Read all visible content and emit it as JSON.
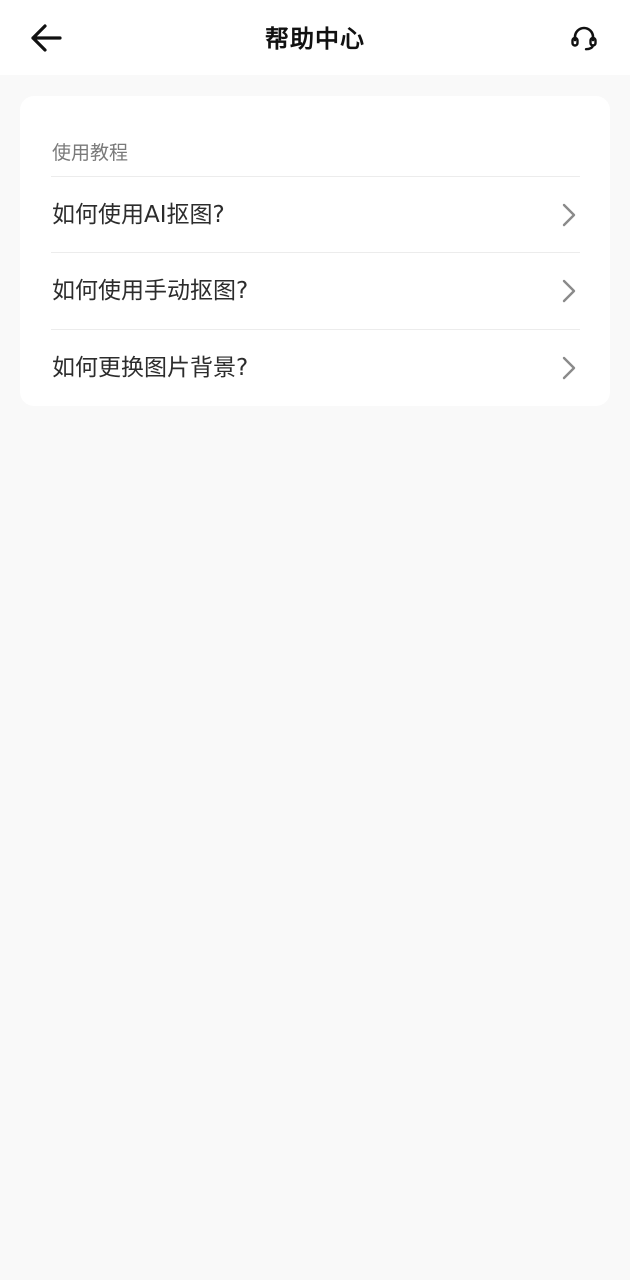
{
  "header": {
    "back_icon": "arrow-left-icon",
    "title": "帮助中心",
    "support_icon": "headset-icon"
  },
  "tutorials": {
    "section_label": "使用教程",
    "items": [
      {
        "label": "如何使用AI抠图?",
        "icon": "chevron-right-icon"
      },
      {
        "label": "如何使用手动抠图?",
        "icon": "chevron-right-icon"
      },
      {
        "label": "如何更换图片背景?",
        "icon": "chevron-right-icon"
      }
    ]
  },
  "colors": {
    "background": "#f9f9f9",
    "card": "#ffffff",
    "title_text": "#111111",
    "item_text": "#2c2c2c",
    "section_text": "#7a7a7a",
    "chevron": "#8a8a8a"
  }
}
